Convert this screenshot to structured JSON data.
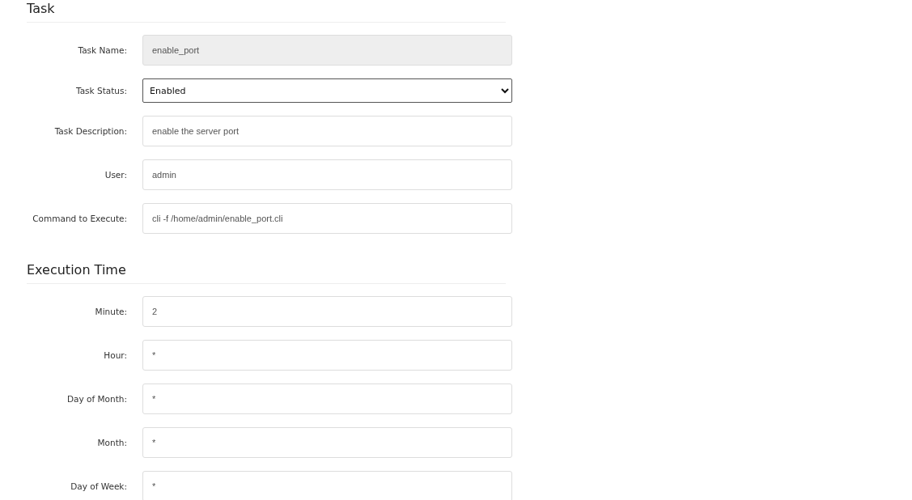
{
  "sections": [
    {
      "title": "Task",
      "fields": [
        {
          "label": "Task Name:",
          "kind": "text",
          "value": "enable_port",
          "disabled": true
        },
        {
          "label": "Task Status:",
          "kind": "select",
          "value": "Enabled",
          "disabled": false
        },
        {
          "label": "Task Description:",
          "kind": "text",
          "value": "enable the server port",
          "disabled": false
        },
        {
          "label": "User:",
          "kind": "text",
          "value": "admin",
          "disabled": false
        },
        {
          "label": "Command to Execute:",
          "kind": "text",
          "value": "cli -f /home/admin/enable_port.cli",
          "disabled": false
        }
      ]
    },
    {
      "title": "Execution Time",
      "fields": [
        {
          "label": "Minute:",
          "kind": "text",
          "value": "2",
          "disabled": false
        },
        {
          "label": "Hour:",
          "kind": "text",
          "value": "*",
          "disabled": false
        },
        {
          "label": "Day of Month:",
          "kind": "text",
          "value": "*",
          "disabled": false
        },
        {
          "label": "Month:",
          "kind": "text",
          "value": "*",
          "disabled": false
        },
        {
          "label": "Day of Week:",
          "kind": "text",
          "value": "*",
          "disabled": false
        }
      ]
    }
  ]
}
